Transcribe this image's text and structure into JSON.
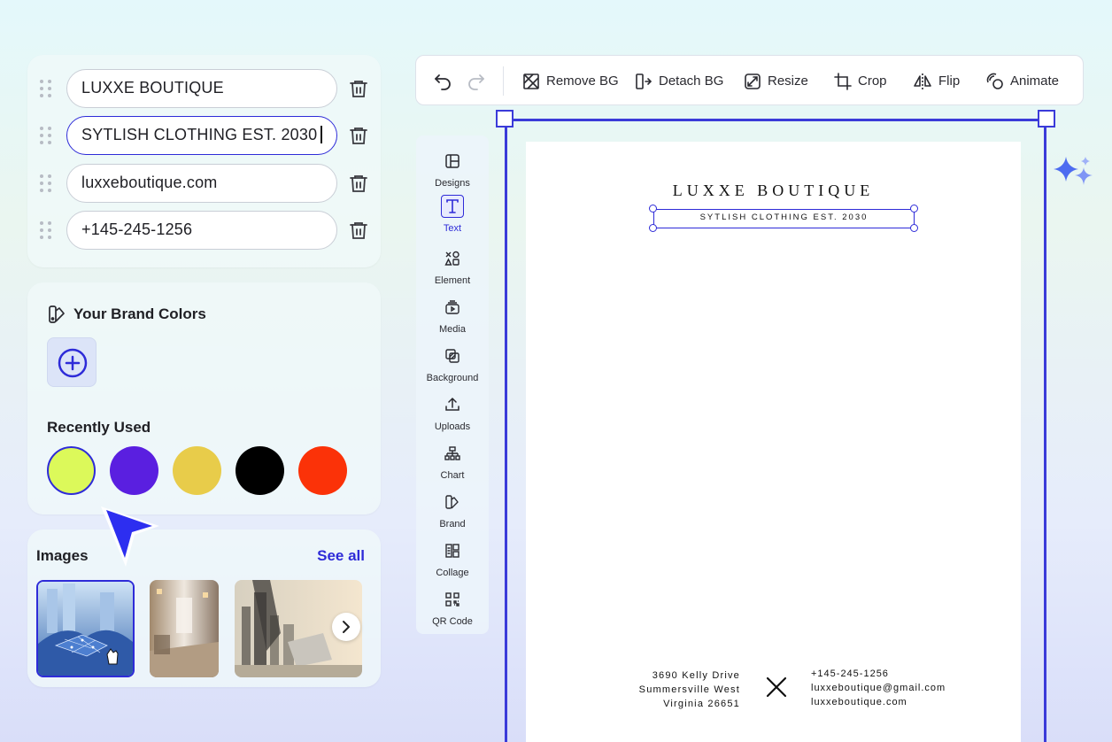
{
  "text_fields": [
    {
      "value": "LUXXE BOUTIQUE",
      "active": false
    },
    {
      "value": "SYTLISH CLOTHING EST. 2030",
      "active": true
    },
    {
      "value": "luxxeboutique.com",
      "active": false
    },
    {
      "value": "+145-245-1256",
      "active": false
    }
  ],
  "brand_colors": {
    "title": "Your Brand Colors",
    "recent_title": "Recently Used",
    "recent": [
      "#dcf95a",
      "#5a1fe0",
      "#e8cc4a",
      "#000000",
      "#fb3208"
    ]
  },
  "images": {
    "title": "Images",
    "see_all": "See all"
  },
  "toolbar": {
    "remove_bg": "Remove BG",
    "detach_bg": "Detach BG",
    "resize": "Resize",
    "crop": "Crop",
    "flip": "Flip",
    "animate": "Animate"
  },
  "sidebar": [
    {
      "label": "Designs",
      "icon": "layout-icon"
    },
    {
      "label": "Text",
      "icon": "text-icon"
    },
    {
      "label": "Element",
      "icon": "shapes-icon"
    },
    {
      "label": "Media",
      "icon": "media-icon"
    },
    {
      "label": "Background",
      "icon": "background-icon"
    },
    {
      "label": "Uploads",
      "icon": "upload-icon"
    },
    {
      "label": "Chart",
      "icon": "chart-icon"
    },
    {
      "label": "Brand",
      "icon": "brand-icon"
    },
    {
      "label": "Collage",
      "icon": "collage-icon"
    },
    {
      "label": "QR Code",
      "icon": "qr-icon"
    }
  ],
  "page": {
    "brand": "LUXXE BOUTIQUE",
    "tagline": "SYTLISH CLOTHING EST. 2030",
    "address": [
      "3690 Kelly Drive",
      "Summersville West",
      "Virginia 26651"
    ],
    "contact": [
      "+145-245-1256",
      "luxxeboutique@gmail.com",
      "luxxeboutique.com"
    ]
  },
  "colors": {
    "accent": "#2e2bd8",
    "frame": "#3b3bd9"
  }
}
